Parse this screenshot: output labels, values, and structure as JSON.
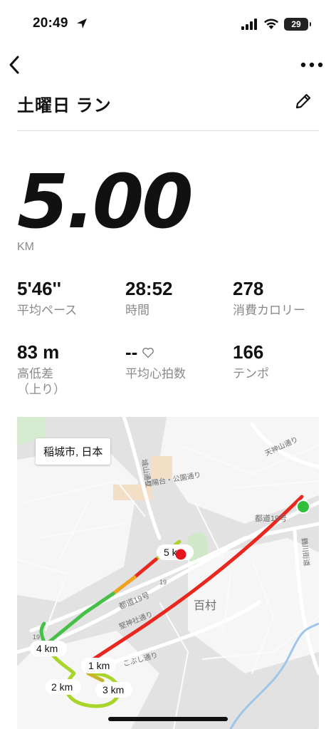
{
  "status": {
    "time": "20:49",
    "battery": "29"
  },
  "header": {
    "title": "土曜日 ラン"
  },
  "summary": {
    "distance": "5.00",
    "distance_unit": "KM"
  },
  "stats": [
    {
      "value": "5'46''",
      "label": "平均ペース"
    },
    {
      "value": "28:52",
      "label": "時間"
    },
    {
      "value": "278",
      "label": "消費カロリー"
    },
    {
      "value": "83 m",
      "label": "高低差\n（上り）"
    },
    {
      "value": "--",
      "label": "平均心拍数"
    },
    {
      "value": "166",
      "label": "テンポ"
    }
  ],
  "map": {
    "location": "稲城市, 日本",
    "km_markers": [
      "1 km",
      "2 km",
      "3 km",
      "4 km",
      "5 km"
    ],
    "map_texts": [
      "百村",
      "都道19号",
      "都道19号",
      "向陽台・公園通り",
      "城山通り",
      "天神山通り",
      "こぶし通り",
      "堅神社通り",
      "鶴川街道",
      "19",
      "19"
    ],
    "colors": {
      "fast": "#e8271e",
      "mid": "#a9d42a",
      "slow": "#47c04a",
      "start": "#2fbf3a",
      "end": "#e4161d"
    }
  }
}
